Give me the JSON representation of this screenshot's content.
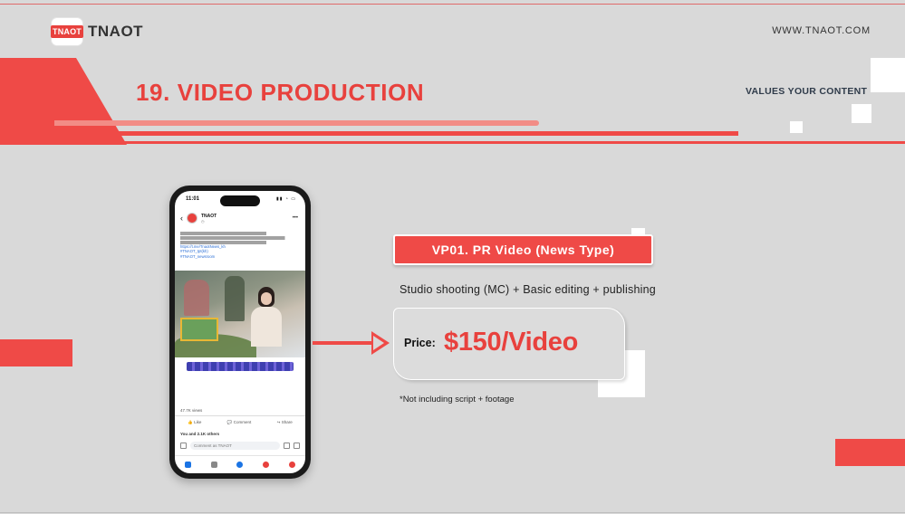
{
  "brand": {
    "logo_badge_text": "TNAOT",
    "logo_word": "TNAOT",
    "website": "WWW.TNAOT.COM",
    "tagline": "VALUES YOUR CONTENT",
    "accent_color": "#ef4a47"
  },
  "slide": {
    "title": "19. VIDEO PRODUCTION"
  },
  "phone_mock": {
    "status_time": "11:01",
    "page_name": "TNAOT",
    "link_1": "https://t.me/TnaotNews_kh",
    "link_2": "#TNAOT_tpt(kh)",
    "link_3": "#TNAOT_newsroom",
    "views": "47.7K views",
    "like_label": "Like",
    "comment_label": "Comment",
    "share_label": "Share",
    "likes_summary": "You and 2.1K others",
    "comment_placeholder": "Comment as TNAOT"
  },
  "offer": {
    "code_title": "VP01. PR Video (News Type)",
    "description": "Studio shooting (MC) + Basic editing + publishing",
    "price_label": "Price:",
    "price_value": "$150/Video",
    "note": "*Not including script + footage"
  }
}
